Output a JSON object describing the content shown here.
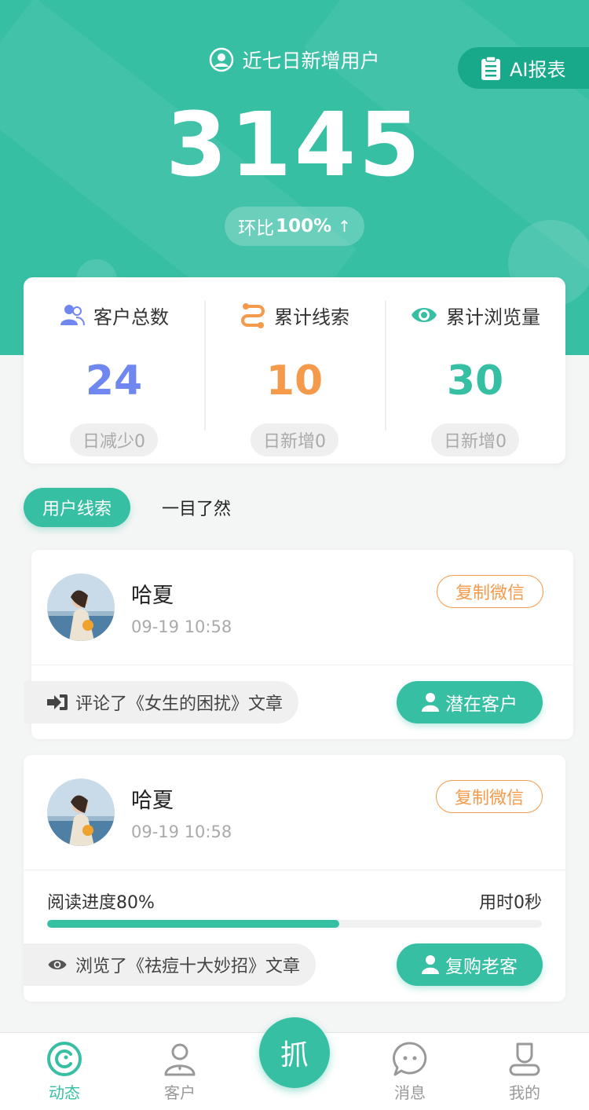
{
  "header": {
    "title": "近七日新增用户",
    "total": "3145",
    "ratio_label": "环比",
    "ratio_value": "100%",
    "ratio_arrow": "↑",
    "ai_report_label": "AI报表"
  },
  "stats": [
    {
      "label": "客户总数",
      "value": "24",
      "sub": "日减少0",
      "color": "#6f87ee",
      "icon": "users-icon"
    },
    {
      "label": "累计线索",
      "value": "10",
      "sub": "日新增0",
      "color": "#f59a4a",
      "icon": "route-icon"
    },
    {
      "label": "累计浏览量",
      "value": "30",
      "sub": "日新增0",
      "color": "#37bfa4",
      "icon": "eye-icon"
    }
  ],
  "tabs": [
    {
      "label": "用户线索",
      "active": true
    },
    {
      "label": "一目了然",
      "active": false
    }
  ],
  "leads": [
    {
      "name": "哈夏",
      "time": "09-19 10:58",
      "copy_label": "复制微信",
      "action_text": "评论了《女生的困扰》文章",
      "action_icon": "sign-in-icon",
      "tag_label": "潜在客户"
    },
    {
      "name": "哈夏",
      "time": "09-19 10:58",
      "copy_label": "复制微信",
      "progress_label": "阅读进度80%",
      "progress_value": 0.59,
      "duration_label": "用时0秒",
      "action_text": "浏览了《祛痘十大妙招》文章",
      "action_icon": "eye-icon",
      "tag_label": "复购老客"
    }
  ],
  "nav": {
    "items": [
      {
        "label": "动态",
        "icon": "dynamic-icon",
        "active": true
      },
      {
        "label": "客户",
        "icon": "customer-icon",
        "active": false
      },
      {
        "label": "消息",
        "icon": "message-icon",
        "active": false
      },
      {
        "label": "我的",
        "icon": "profile-icon",
        "active": false
      }
    ],
    "center_label": "抓"
  },
  "colors": {
    "primary": "#37bfa4",
    "primary_dark": "#18a98b",
    "orange": "#f59a4a",
    "blue": "#6f87ee"
  }
}
